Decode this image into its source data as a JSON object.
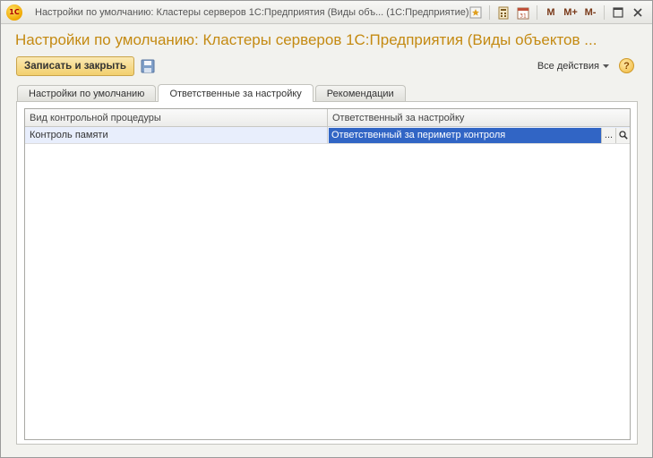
{
  "window": {
    "app_logo": "1С",
    "title": "Настройки по умолчанию: Кластеры серверов 1С:Предприятия (Виды объ...   (1С:Предприятие)",
    "tools": {
      "m": "M",
      "m_plus": "M+",
      "m_minus": "M-"
    }
  },
  "page": {
    "title": "Настройки по умолчанию: Кластеры серверов 1С:Предприятия (Виды объектов ..."
  },
  "toolbar": {
    "save_close_label": "Записать и закрыть",
    "all_actions_label": "Все действия",
    "help_label": "?"
  },
  "tabs": [
    {
      "label": "Настройки по умолчанию",
      "active": false
    },
    {
      "label": "Ответственные за настройку",
      "active": true
    },
    {
      "label": "Рекомендации",
      "active": false
    }
  ],
  "grid": {
    "columns": [
      "Вид контрольной процедуры",
      "Ответственный за настройку"
    ],
    "rows": [
      {
        "procedure": "Контроль памяти",
        "responsible": "Ответственный за периметр контроля"
      }
    ],
    "ellipsis_label": "...",
    "selection_color": "#3165c5"
  },
  "colors": {
    "title_accent": "#c48a12",
    "button_yellow": "#f2cf6d"
  }
}
